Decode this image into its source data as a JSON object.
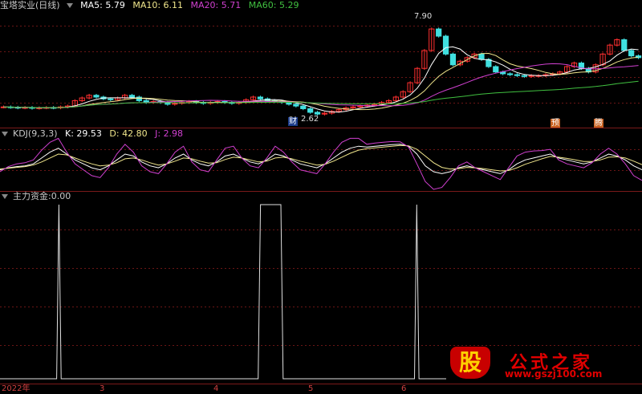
{
  "header": {
    "stock_title": "宝塔实业(日线)",
    "ma": [
      {
        "label": "MA5:",
        "value": "5.79",
        "color": "#ffffff"
      },
      {
        "label": "MA10:",
        "value": "6.11",
        "color": "#f0e68c"
      },
      {
        "label": "MA20:",
        "value": "5.71",
        "color": "#d040d0"
      },
      {
        "label": "MA60:",
        "value": "5.29",
        "color": "#40c040"
      }
    ]
  },
  "kdj_header": {
    "title": "KDJ(9,3,3)",
    "k": {
      "label": "K:",
      "value": "29.53",
      "color": "#ffffff"
    },
    "d": {
      "label": "D:",
      "value": "42.80",
      "color": "#f0e68c"
    },
    "j": {
      "label": "J:",
      "value": "2.98",
      "color": "#d040d0"
    }
  },
  "fund_header": {
    "title": "主力资金",
    "value": ":0.00"
  },
  "annotations": {
    "high_label": "7.90",
    "low_label": "2.62",
    "signal_cai": "财",
    "signal_yu": "预",
    "signal_teng": "腾"
  },
  "xaxis": {
    "labels": [
      "2022年",
      "3",
      "4",
      "5",
      "6"
    ]
  },
  "watermark": {
    "logo": "股",
    "title": "公式之家",
    "url": "www.gszj100.com"
  },
  "chart_data": [
    {
      "type": "candlestick",
      "title": "宝塔实业(日线)",
      "yrange": [
        2.3,
        8.3
      ],
      "high": 7.9,
      "low": 2.62,
      "closes": [
        3.05,
        3.03,
        3.0,
        3.02,
        2.98,
        3.0,
        3.02,
        3.0,
        3.05,
        3.1,
        3.4,
        3.55,
        3.7,
        3.6,
        3.5,
        3.45,
        3.55,
        3.7,
        3.6,
        3.4,
        3.3,
        3.35,
        3.3,
        3.2,
        3.25,
        3.3,
        3.35,
        3.3,
        3.25,
        3.3,
        3.35,
        3.3,
        3.25,
        3.3,
        3.45,
        3.6,
        3.5,
        3.4,
        3.35,
        3.3,
        3.2,
        3.1,
        2.95,
        2.75,
        2.65,
        2.7,
        2.8,
        2.9,
        3.0,
        3.05,
        3.1,
        3.15,
        3.2,
        3.3,
        3.4,
        3.6,
        3.9,
        4.4,
        5.2,
        6.2,
        7.4,
        7.0,
        6.0,
        5.4,
        5.6,
        5.8,
        6.0,
        5.7,
        5.3,
        5.0,
        4.9,
        4.85,
        4.8,
        4.75,
        4.8,
        4.8,
        4.85,
        4.9,
        5.0,
        5.3,
        5.5,
        5.2,
        5.0,
        5.4,
        6.0,
        6.5,
        6.8,
        6.2,
        5.9,
        5.8
      ],
      "ma5_last": 5.79,
      "ma10_last": 6.11,
      "ma20_last": 5.71,
      "ma60_last": 5.29
    },
    {
      "type": "line",
      "title": "KDJ(9,3,3)",
      "yrange": [
        0,
        100
      ],
      "series": [
        {
          "name": "K",
          "values": [
            30,
            35,
            38,
            40,
            45,
            60,
            75,
            85,
            70,
            55,
            45,
            35,
            30,
            40,
            55,
            70,
            65,
            50,
            40,
            35,
            45,
            60,
            70,
            55,
            45,
            40,
            50,
            65,
            70,
            60,
            50,
            45,
            55,
            70,
            65,
            55,
            45,
            40,
            35,
            45,
            60,
            75,
            85,
            90,
            88,
            90,
            92,
            94,
            95,
            90,
            70,
            40,
            25,
            20,
            25,
            35,
            40,
            35,
            30,
            25,
            20,
            30,
            45,
            55,
            60,
            65,
            70,
            60,
            55,
            50,
            45,
            50,
            60,
            70,
            65,
            55,
            40,
            30
          ]
        },
        {
          "name": "D",
          "values": [
            32,
            34,
            36,
            38,
            42,
            50,
            60,
            70,
            68,
            60,
            52,
            45,
            40,
            42,
            48,
            58,
            60,
            55,
            48,
            42,
            45,
            52,
            60,
            58,
            52,
            47,
            48,
            56,
            62,
            60,
            55,
            50,
            52,
            60,
            62,
            58,
            52,
            47,
            42,
            44,
            52,
            62,
            72,
            80,
            84,
            86,
            88,
            90,
            92,
            91,
            82,
            65,
            48,
            36,
            32,
            33,
            36,
            35,
            33,
            30,
            27,
            28,
            35,
            44,
            51,
            58,
            64,
            62,
            59,
            55,
            51,
            51,
            55,
            62,
            63,
            60,
            52,
            43
          ]
        },
        {
          "name": "J",
          "values": [
            25,
            38,
            45,
            48,
            55,
            80,
            100,
            110,
            75,
            45,
            30,
            15,
            10,
            35,
            70,
            95,
            75,
            40,
            25,
            20,
            45,
            75,
            90,
            50,
            30,
            25,
            55,
            85,
            90,
            60,
            40,
            35,
            60,
            90,
            75,
            50,
            30,
            25,
            20,
            45,
            75,
            100,
            110,
            110,
            95,
            98,
            100,
            102,
            101,
            88,
            45,
            0,
            -20,
            -15,
            10,
            40,
            50,
            35,
            25,
            15,
            5,
            35,
            65,
            75,
            78,
            79,
            82,
            55,
            45,
            40,
            35,
            48,
            70,
            85,
            70,
            45,
            15,
            3
          ]
        }
      ]
    },
    {
      "type": "line",
      "title": "主力资金",
      "yrange": [
        0,
        1
      ],
      "values": [
        0,
        0,
        0,
        0,
        0,
        0,
        0,
        0,
        0,
        0,
        0,
        0,
        0,
        0,
        0,
        0,
        0,
        0,
        0,
        0,
        0,
        0,
        0,
        0,
        0,
        0,
        1,
        0,
        0,
        0,
        0,
        0,
        0,
        0,
        0,
        0,
        0,
        0,
        0,
        0,
        0,
        0,
        0,
        0,
        0,
        0,
        0,
        0,
        0,
        0,
        0,
        0,
        0,
        0,
        0,
        0,
        0,
        0,
        0,
        0,
        0,
        0,
        0,
        0,
        0,
        0,
        0,
        0,
        0,
        0,
        0,
        0,
        0,
        0,
        0,
        0,
        0,
        0,
        0,
        0,
        0,
        0,
        0,
        0,
        0,
        0,
        0,
        0,
        0,
        0,
        0,
        0,
        0,
        0,
        0,
        0,
        0,
        0,
        0,
        0,
        0,
        0,
        0,
        0,
        0,
        0,
        0,
        0,
        0,
        0,
        0,
        0,
        0,
        0,
        0,
        1,
        1,
        1,
        1,
        1,
        1,
        1,
        1,
        1,
        1,
        0,
        0,
        0,
        0,
        0,
        0,
        0,
        0,
        0,
        0,
        0,
        0,
        0,
        0,
        0,
        0,
        0,
        0,
        0,
        0,
        0,
        0,
        0,
        0,
        0,
        0,
        0,
        0,
        0,
        0,
        0,
        0,
        0,
        0,
        0,
        0,
        0,
        0,
        0,
        0,
        0,
        0,
        0,
        0,
        0,
        0,
        0,
        0,
        0,
        0,
        0,
        0,
        0,
        0,
        0,
        0,
        0,
        0,
        0,
        1,
        0,
        0,
        0,
        0,
        0,
        0,
        0,
        0,
        0,
        0,
        0,
        0,
        0
      ]
    }
  ]
}
